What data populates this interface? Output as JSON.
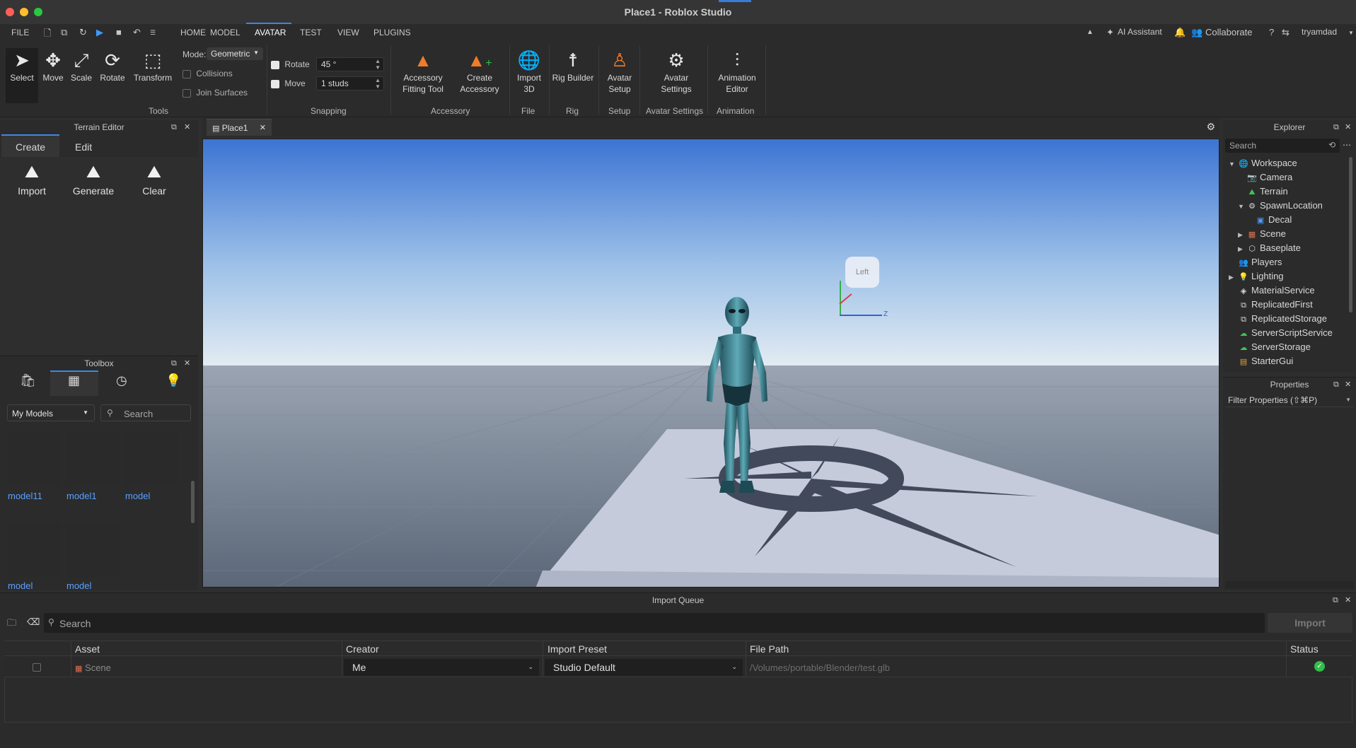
{
  "window": {
    "title": "Place1 - Roblox Studio"
  },
  "menu": {
    "file": "FILE",
    "tabs": [
      "HOME",
      "MODEL",
      "AVATAR",
      "TEST",
      "VIEW",
      "PLUGINS"
    ],
    "active_tab": "AVATAR",
    "right": {
      "ai_assistant": "AI Assistant",
      "collaborate": "Collaborate",
      "user": "tryamdad"
    }
  },
  "ribbon": {
    "tools": {
      "select": "Select",
      "move": "Move",
      "scale": "Scale",
      "rotate": "Rotate",
      "transform": "Transform",
      "group": "Tools",
      "mode_label": "Mode:",
      "mode_value": "Geometric",
      "collisions": "Collisions",
      "join_surfaces": "Join Surfaces"
    },
    "snapping": {
      "rotate_label": "Rotate",
      "rotate_value": "45 °",
      "move_label": "Move",
      "move_value": "1 studs",
      "group": "Snapping"
    },
    "accessory": {
      "fitting_line1": "Accessory",
      "fitting_line2": "Fitting Tool",
      "create_line1": "Create",
      "create_line2": "Accessory",
      "group": "Accessory"
    },
    "file": {
      "import_line1": "Import",
      "import_line2": "3D",
      "group": "File"
    },
    "rig": {
      "builder": "Rig Builder",
      "group": "Rig"
    },
    "setup": {
      "line1": "Avatar",
      "line2": "Setup",
      "group": "Setup"
    },
    "avatar_settings": {
      "line1": "Avatar",
      "line2": "Settings",
      "group": "Avatar Settings"
    },
    "animation": {
      "line1": "Animation",
      "line2": "Editor",
      "group": "Animation"
    }
  },
  "terrain_editor": {
    "title": "Terrain Editor",
    "tabs": [
      "Create",
      "Edit"
    ],
    "tools": [
      "Import",
      "Generate",
      "Clear"
    ]
  },
  "toolbox": {
    "title": "Toolbox",
    "category": "My Models",
    "search_placeholder": "Search",
    "models": [
      "model11",
      "model1",
      "model",
      "model",
      "model"
    ]
  },
  "viewport": {
    "tab": "Place1",
    "view_cube_label": "Left",
    "axis_z": "Z"
  },
  "explorer": {
    "title": "Explorer",
    "search_placeholder": "Search",
    "items": [
      "Workspace",
      "Camera",
      "Terrain",
      "SpawnLocation",
      "Decal",
      "Scene",
      "Baseplate",
      "Players",
      "Lighting",
      "MaterialService",
      "ReplicatedFirst",
      "ReplicatedStorage",
      "ServerScriptService",
      "ServerStorage",
      "StarterGui"
    ]
  },
  "properties": {
    "title": "Properties",
    "filter_placeholder": "Filter Properties (⇧⌘P)"
  },
  "import_queue": {
    "title": "Import Queue",
    "search_placeholder": "Search",
    "import_button": "Import",
    "columns": [
      "Asset",
      "Creator",
      "Import Preset",
      "File Path",
      "Status"
    ],
    "rows": [
      {
        "asset": "Scene",
        "creator": "Me",
        "preset": "Studio Default",
        "path": "/Volumes/portable/Blender/test.glb",
        "status": "success"
      }
    ]
  },
  "colors": {
    "accent": "#3d87e6",
    "link": "#5aa0ff",
    "success": "#2fbf4a",
    "sky_top": "#3c78d8",
    "sky_horizon": "#dce6ef"
  }
}
